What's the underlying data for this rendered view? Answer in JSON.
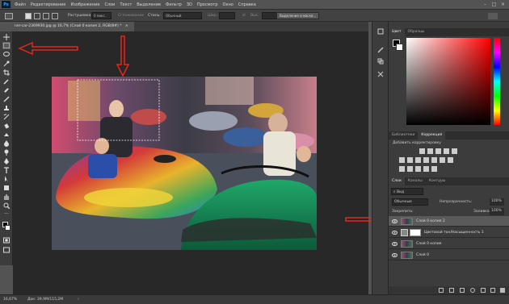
{
  "app": {
    "logo": "Ps"
  },
  "menu": [
    "Файл",
    "Редактирование",
    "Изображение",
    "Слои",
    "Текст",
    "Выделение",
    "Фильтр",
    "3D",
    "Просмотр",
    "Окно",
    "Справка"
  ],
  "options": {
    "feather_label": "Растушевка:",
    "feather_value": "0 пикс.",
    "antialias_label": "Сглаживание",
    "style_label": "Стиль:",
    "style_value": "Обычный",
    "width_label": "Шир.:",
    "height_label": "Выс.:",
    "refine_button": "Выделение и маска..."
  },
  "document": {
    "tab_title": "ner-car-2369930.jpg @ 16,7% (Слой 0 копия 2, RGB/8#) *",
    "tab_close": "×"
  },
  "status": {
    "zoom": "16,67%",
    "doc_info": "Док: 39,9M/115,2M"
  },
  "color_panel": {
    "tabs": [
      "Цвет",
      "Образцы"
    ],
    "active": 0
  },
  "adjust_panel": {
    "tabs": [
      "Библиотеки",
      "Коррекция"
    ],
    "active": 1,
    "title": "Добавить корректировку"
  },
  "layers_panel": {
    "tabs": [
      "Слои",
      "Каналы",
      "Контуры"
    ],
    "active": 0,
    "filter_label": "Вид",
    "blend_mode": "Обычные",
    "opacity_label": "Непрозрачность:",
    "opacity_value": "100%",
    "lock_label": "Закрепить:",
    "fill_label": "Заливка:",
    "fill_value": "100%",
    "layers": [
      {
        "name": "Слой 0 копия 2",
        "selected": true
      },
      {
        "name": "Цветовой тон/Насыщенность 1",
        "selected": false
      },
      {
        "name": "Слой 0 копия",
        "selected": false
      },
      {
        "name": "Слой 0",
        "selected": false
      }
    ]
  },
  "colors": {
    "annotation": "#e8261a",
    "selection_bg": "#5a5a5a"
  },
  "icons": [
    "move-icon",
    "marquee-icon",
    "lasso-icon",
    "quick-select-icon",
    "crop-icon",
    "eyedropper-icon",
    "healing-icon",
    "brush-icon",
    "stamp-icon",
    "history-brush-icon",
    "eraser-icon",
    "gradient-icon",
    "blur-icon",
    "dodge-icon",
    "pen-icon",
    "type-icon",
    "path-select-icon",
    "shape-icon",
    "hand-icon",
    "zoom-icon",
    "more-icon",
    "colors-icon",
    "quickmask-icon",
    "screenmode-icon"
  ]
}
